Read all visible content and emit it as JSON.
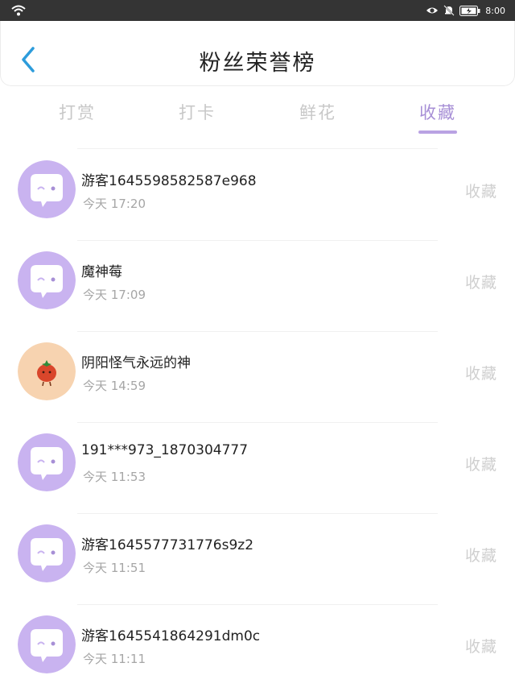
{
  "status_bar": {
    "time": "8:00",
    "icons": [
      "wifi-icon",
      "eye-icon",
      "mute-bell-icon",
      "battery-icon"
    ]
  },
  "header": {
    "title": "粉丝荣誉榜",
    "back_icon": "chevron-left-icon",
    "accent_color": "#2d9cdb"
  },
  "tabs": [
    {
      "label": "打赏",
      "active": false
    },
    {
      "label": "打卡",
      "active": false
    },
    {
      "label": "鲜花",
      "active": false
    },
    {
      "label": "收藏",
      "active": true
    }
  ],
  "colors": {
    "active_tab": "#a78fd6",
    "avatar_purple": "#c9b3f0",
    "avatar_peach": "#f7d3b0"
  },
  "fans": [
    {
      "name": "游客1645598582587e968",
      "time": "今天 17:20",
      "action": "收藏",
      "avatar": "chat-bubble-avatar"
    },
    {
      "name": "魔神莓",
      "time": "今天 17:09",
      "action": "收藏",
      "avatar": "chat-bubble-avatar"
    },
    {
      "name": "阴阳怪气永远的神",
      "time": "今天 14:59",
      "action": "收藏",
      "avatar": "tomato-avatar"
    },
    {
      "name": "191***973_1870304777",
      "time": "今天 11:53",
      "action": "收藏",
      "avatar": "chat-bubble-avatar"
    },
    {
      "name": "游客1645577731776s9z2",
      "time": "今天 11:51",
      "action": "收藏",
      "avatar": "chat-bubble-avatar"
    },
    {
      "name": "游客1645541864291dm0c",
      "time": "今天 11:11",
      "action": "收藏",
      "avatar": "chat-bubble-avatar"
    }
  ]
}
